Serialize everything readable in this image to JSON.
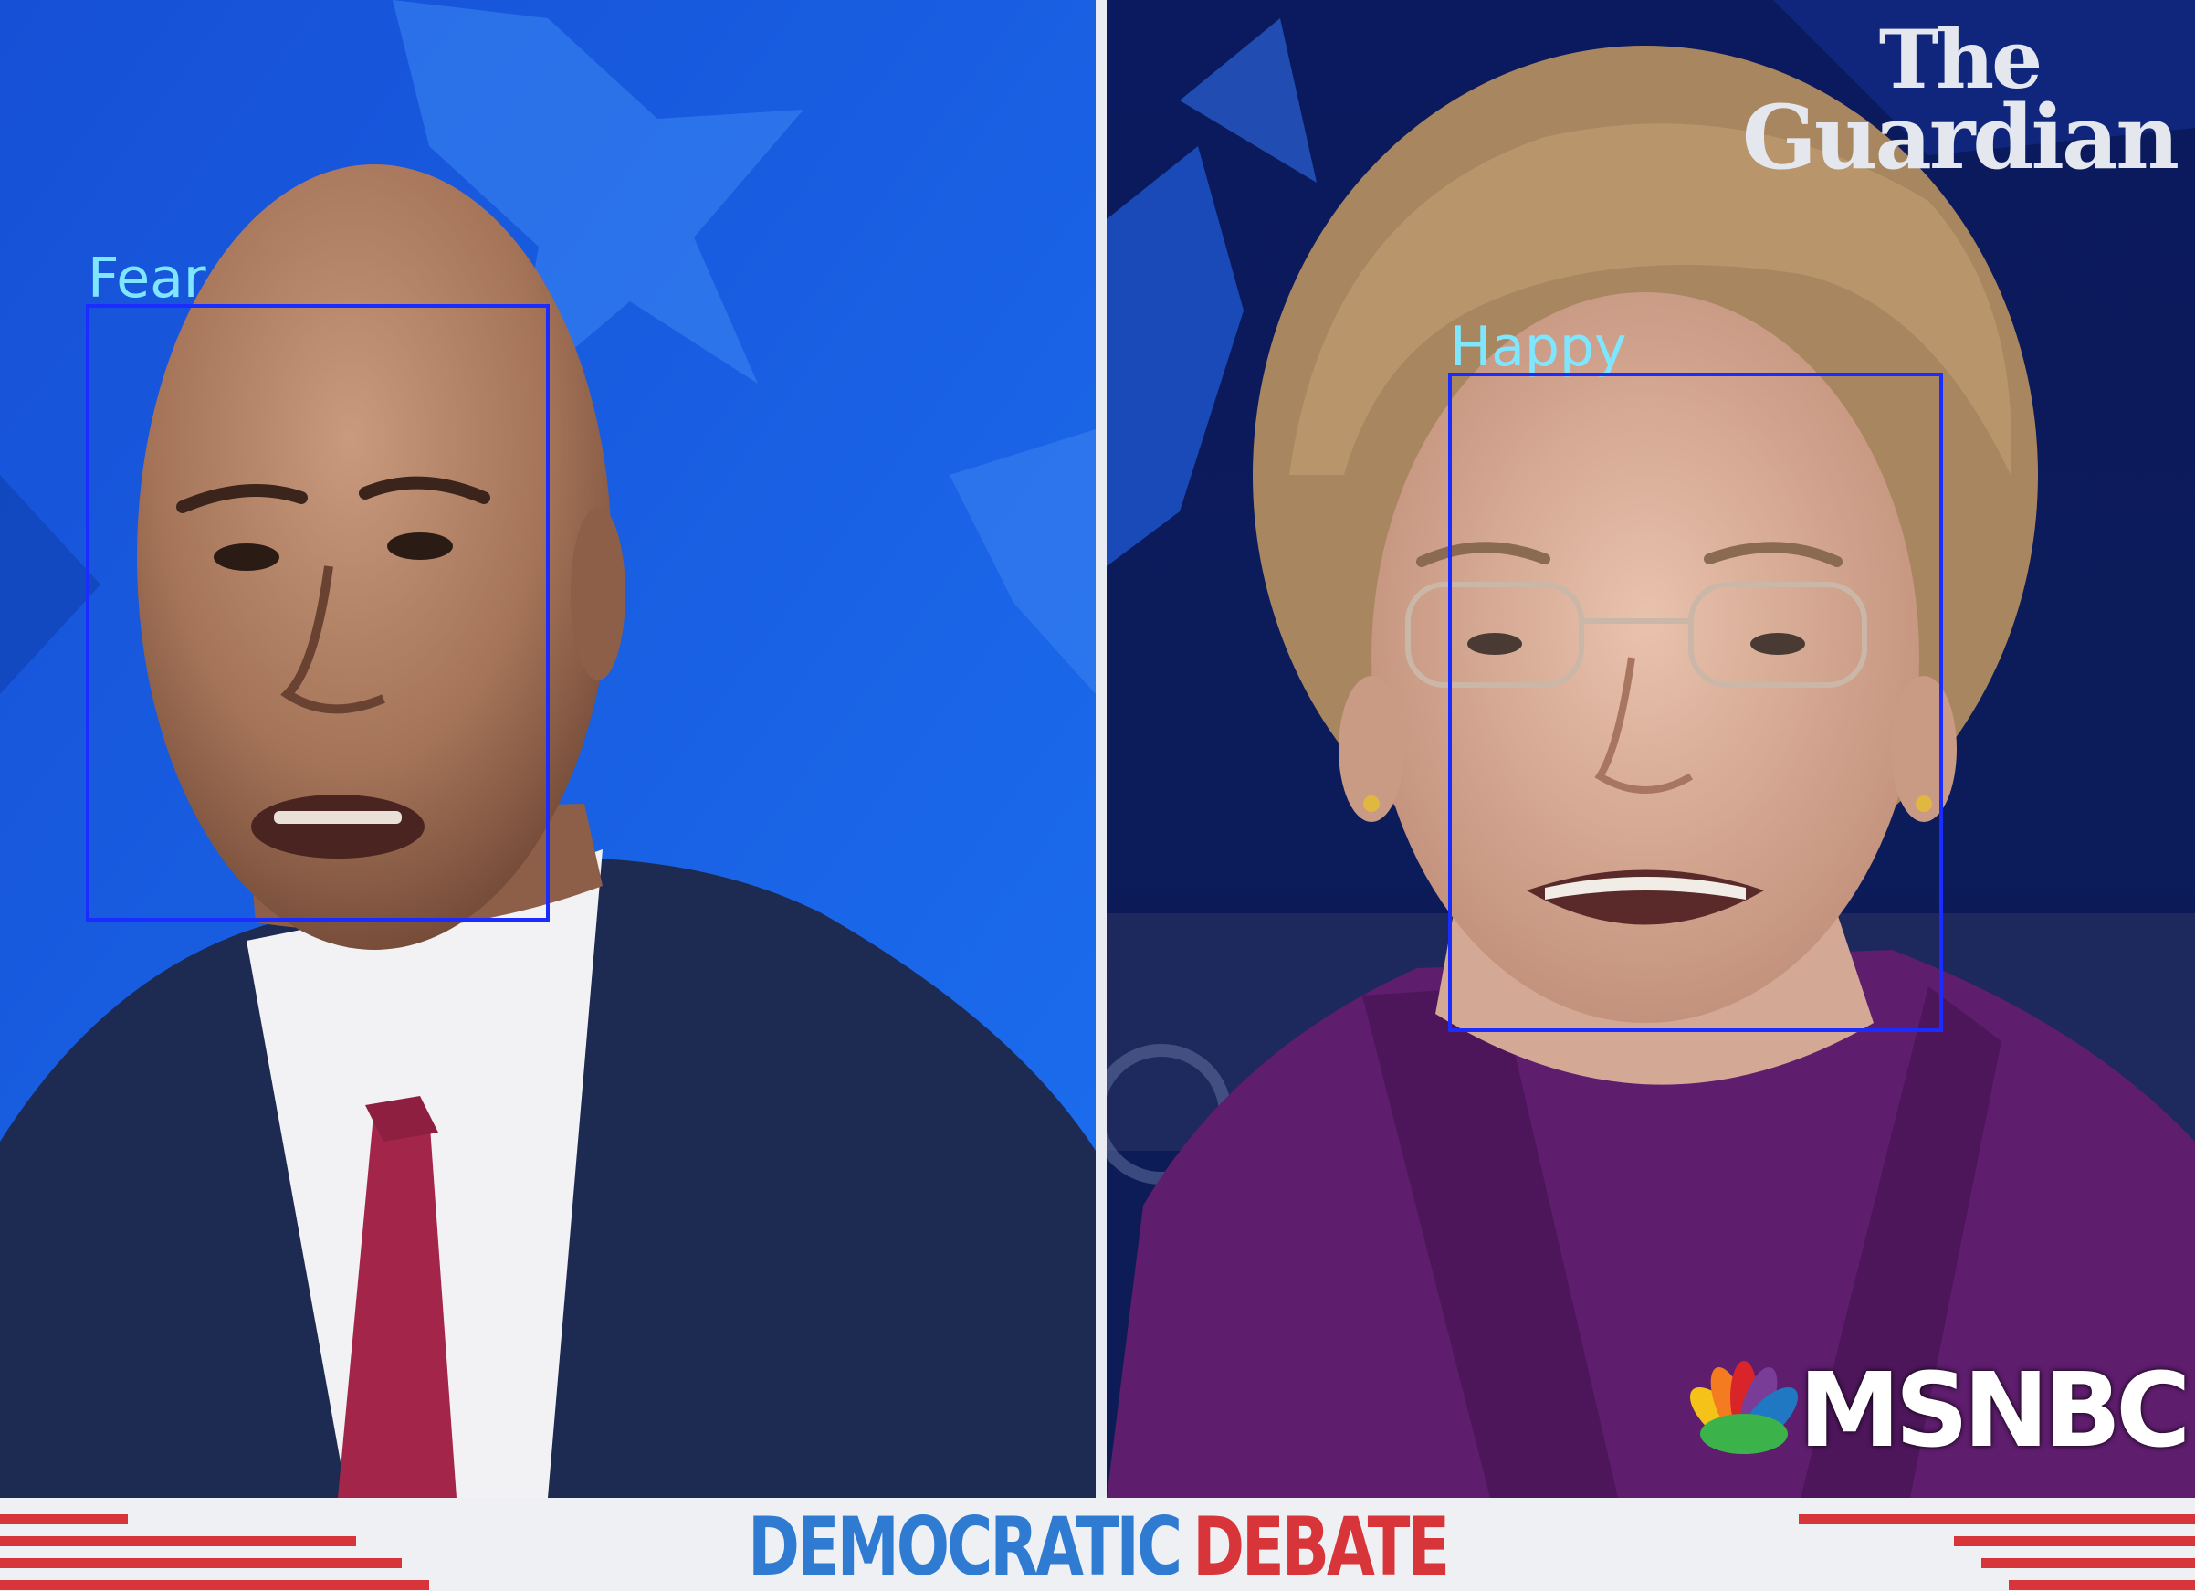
{
  "detections": [
    {
      "label": "Fear"
    },
    {
      "label": "Happy"
    }
  ],
  "watermark": {
    "line1": "The",
    "line2": "Guardian"
  },
  "network": {
    "name": "MSNBC"
  },
  "chyron": {
    "word1": "DEMOCRATIC",
    "word2": "DEBATE"
  },
  "colors": {
    "box": "#1a2cff",
    "label": "#7fe6ff",
    "stage_blue": "#1559d8",
    "chyron_blue": "#2f7bd2",
    "chyron_red": "#d8353a"
  }
}
